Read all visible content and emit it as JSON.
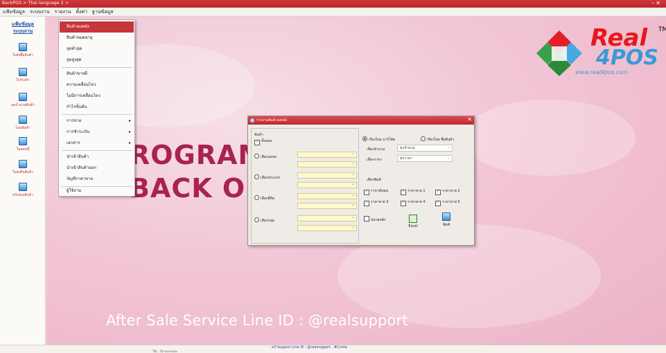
{
  "window": {
    "title": "BackPOS > Thai language 2 >"
  },
  "menubar": [
    "แฟ้มข้อมูล",
    "ระบบงาน",
    "รายงาน",
    "ตั้งค่า",
    "ฐานข้อมูล"
  ],
  "sidebar": {
    "header": [
      "แฟ้มข้อมูล",
      "ระบบงาน"
    ],
    "items": [
      {
        "label": "ใบสั่งซื้อสินค้า",
        "icon": "document-icon"
      },
      {
        "label": "ใบรับเข้า",
        "icon": "receive-icon"
      },
      {
        "label": "ลดจำนวนสินค้า",
        "icon": "reduce-icon"
      },
      {
        "label": "โอนสินค้า",
        "icon": "transfer-icon"
      },
      {
        "label": "ใบลดหนี้",
        "icon": "credit-note-icon"
      },
      {
        "label": "ใบส่งคืนสินค้า",
        "icon": "return-icon"
      },
      {
        "label": "ปรับปรุงสินค้า",
        "icon": "adjust-icon"
      }
    ]
  },
  "dropdown": {
    "items": [
      {
        "label": "สินค้าคงคลัง",
        "active": true
      },
      {
        "label": "สินค้าหมดอายุ"
      },
      {
        "label": "จุดต่ำสุด"
      },
      {
        "label": "จุดสูงสุด"
      },
      {
        "label": "สินค้าขายดี"
      },
      {
        "label": "ความเคลื่อนไหว"
      },
      {
        "label": "ไม่มีการเคลื่อนไหว"
      },
      {
        "label": "กำไรขั้นต้น"
      },
      {
        "label": "การขาย",
        "submenu": true
      },
      {
        "label": "การชำระเงิน",
        "submenu": true
      },
      {
        "label": "เอกสาร",
        "submenu": true
      },
      {
        "label": "นำเข้าสินค้า"
      },
      {
        "label": "นำเข้าสินค้าออก"
      },
      {
        "label": "บัญชีราคาขาย"
      },
      {
        "label": "ผู้ใช้งาน"
      }
    ]
  },
  "desktop": {
    "program_line1": "ROGRAM",
    "program_line2": "BACK O",
    "after_sale": "After Sale Service Line ID : @realsupport"
  },
  "logo": {
    "real": "Real",
    "fourpos": "4POS",
    "url": "www.real4pos.com",
    "tm": "TM"
  },
  "dialog": {
    "title": "รายงานสินค้าคงคลัง",
    "left": {
      "section_label": "สินค้า",
      "all_label": "ทั้งหมด",
      "radios": [
        "เลือกแผนก",
        "เลือกประเภท",
        "เลือกยี่ห้อ",
        "เลือกกลุ่ม"
      ]
    },
    "right": {
      "sort_by_code": "เรียงโดย บาร์โค้ด",
      "sort_by_name": "เรียงโดย ชื่อสินค้า",
      "qty_label": "เลือกจำนวน",
      "qty_value": "ทุกจำนวน",
      "price_label": "เลือกราคา",
      "price_value": "ทุกราคา",
      "print_label": "เลือกพิมพ์",
      "checks": [
        "ราคาต้นทุน",
        "ราคาขาย 1",
        "ราคาขาย 2",
        "ราคาขาย 3",
        "ราคาขาย 4",
        "ราคาขาย 5"
      ],
      "alt_unit": "หน่วยหลัก",
      "excel_label": "Excel",
      "print_button": "พิมพ์"
    }
  },
  "status": {
    "line1": "e3 Support Line ID : @realsupport , #Conta",
    "line2": "TEL : 02-xxx-xxxx"
  }
}
